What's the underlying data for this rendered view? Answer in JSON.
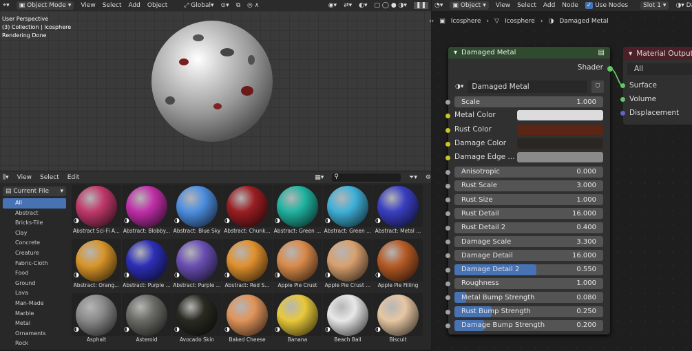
{
  "viewport": {
    "mode": "Object Mode",
    "menus": [
      "View",
      "Select",
      "Add",
      "Object"
    ],
    "orientation": "Global",
    "info": [
      "User Perspective",
      "(3) Collection | Icosphere",
      "Rendering Done"
    ]
  },
  "node_header": {
    "type": "Object",
    "menus": [
      "View",
      "Select",
      "Add",
      "Node"
    ],
    "use_nodes": "Use Nodes",
    "slot": "Slot 1",
    "breadcrumb": [
      "Icosphere",
      "Icosphere",
      "Damaged Metal"
    ]
  },
  "asset_browser": {
    "menus": [
      "View",
      "Select",
      "Edit"
    ],
    "library": "Current File",
    "categories": [
      "All",
      "Abstract",
      "Bricks-Tile",
      "Clay",
      "Concrete",
      "Creature",
      "Fabric-Cloth",
      "Food",
      "Ground",
      "Lava",
      "Man-Made",
      "Marble",
      "Metal",
      "Ornaments",
      "Rock"
    ],
    "assets": [
      {
        "label": "Abstract Sci-Fi A...",
        "color": "#c0396a"
      },
      {
        "label": "Abstract: Blobby...",
        "color": "#c02fa8"
      },
      {
        "label": "Abstract: Blue Sky",
        "color": "#4d8ee0"
      },
      {
        "label": "Abstract: Chunk...",
        "color": "#9a1e22"
      },
      {
        "label": "Abstract: Green ...",
        "color": "#20b3a0"
      },
      {
        "label": "Abstract: Green ...",
        "color": "#3fb0d8"
      },
      {
        "label": "Abstract: Metal ...",
        "color": "#3a3fc2"
      },
      {
        "label": "Abstract: Orang...",
        "color": "#d8952a"
      },
      {
        "label": "Abstract: Purple ...",
        "color": "#2d2fb8"
      },
      {
        "label": "Abstract: Purple ...",
        "color": "#6a4eb3"
      },
      {
        "label": "Abstract: Red S...",
        "color": "#e0902e"
      },
      {
        "label": "Apple Pie Crust",
        "color": "#d98a4a"
      },
      {
        "label": "Apple Pie Crust ...",
        "color": "#d8a06e"
      },
      {
        "label": "Apple Pie Filling",
        "color": "#b55a25"
      },
      {
        "label": "Asphalt",
        "color": "#8a8a8a"
      },
      {
        "label": "Asteroid",
        "color": "#6a6a66"
      },
      {
        "label": "Avocado Skin",
        "color": "#2a2a22"
      },
      {
        "label": "Baked Cheese",
        "color": "#e0945a"
      },
      {
        "label": "Banana",
        "color": "#e8c93a"
      },
      {
        "label": "Beach Ball",
        "color": "#e8e8e8"
      },
      {
        "label": "Biscuit",
        "color": "#e7c7a3"
      }
    ]
  },
  "node": {
    "title": "Damaged Metal",
    "material": "Damaged Metal",
    "output": "Shader",
    "rows": [
      {
        "label": "Scale",
        "value": "1.000",
        "kind": "num",
        "fill": 0
      },
      {
        "label": "Metal Color",
        "kind": "color",
        "color": "#dcdcdc"
      },
      {
        "label": "Rust Color",
        "kind": "color",
        "color": "#5a2514"
      },
      {
        "label": "Damage Color",
        "kind": "color",
        "color": "#2a2622"
      },
      {
        "label": "Damage Edge ...",
        "kind": "color",
        "color": "#8a8a8a"
      },
      {
        "label": "Anisotropic",
        "value": "0.000",
        "kind": "num",
        "fill": 0
      },
      {
        "label": "Rust Scale",
        "value": "3.000",
        "kind": "num",
        "fill": 0
      },
      {
        "label": "Rust Size",
        "value": "1.000",
        "kind": "num",
        "fill": 0
      },
      {
        "label": "Rust Detail",
        "value": "16.000",
        "kind": "num",
        "fill": 0
      },
      {
        "label": "Rust Detail 2",
        "value": "0.400",
        "kind": "num",
        "fill": 0
      },
      {
        "label": "Damage Scale",
        "value": "3.300",
        "kind": "num",
        "fill": 0
      },
      {
        "label": "Damage Detail",
        "value": "16.000",
        "kind": "num",
        "fill": 0
      },
      {
        "label": "Damage Detail 2",
        "value": "0.550",
        "kind": "num",
        "fill": 0.55
      },
      {
        "label": "Roughness",
        "value": "1.000",
        "kind": "num",
        "fill": 0
      },
      {
        "label": "Metal Bump Strength",
        "value": "0.080",
        "kind": "num",
        "fill": 0.08
      },
      {
        "label": "Rust Bump Strength",
        "value": "0.250",
        "kind": "num",
        "fill": 0.25
      },
      {
        "label": "Damage Bump Strength",
        "value": "0.200",
        "kind": "num",
        "fill": 0.2
      }
    ]
  },
  "output_node": {
    "title": "Material Output",
    "target": "All",
    "sockets": [
      "Surface",
      "Volume",
      "Displacement"
    ]
  }
}
